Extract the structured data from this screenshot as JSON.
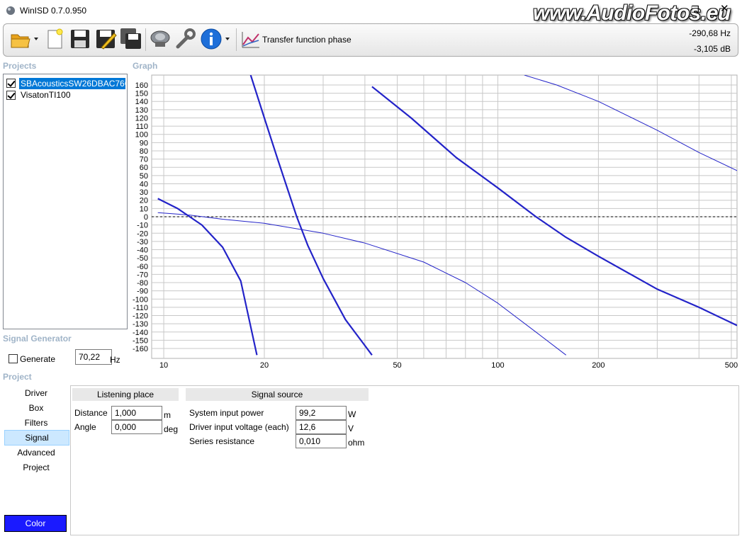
{
  "window": {
    "title": "WinISD 0.7.0.950",
    "watermark": "www.AudioFotos.eu",
    "maximize_glyph": "❐",
    "close_glyph": "✕"
  },
  "toolbar": {
    "buttons": [
      {
        "name": "open-folder-icon"
      },
      {
        "name": "new-project-icon"
      },
      {
        "name": "save-icon"
      },
      {
        "name": "save-edit-icon"
      },
      {
        "name": "save-all-icon"
      },
      {
        "name": "driver-icon"
      },
      {
        "name": "wrench-icon"
      },
      {
        "name": "info-icon"
      },
      {
        "name": "graph-type-icon"
      }
    ],
    "graph_type_label": "Transfer function phase",
    "readout_hz": "-290,68 Hz",
    "readout_db": "-3,105 dB"
  },
  "projects": {
    "header": "Projects",
    "items": [
      {
        "label": "SBAcousticsSW26DBAC76CI",
        "checked": true,
        "selected": true
      },
      {
        "label": "VisatonTI100",
        "checked": true,
        "selected": false
      }
    ]
  },
  "graph": {
    "header": "Graph"
  },
  "signal_generator": {
    "header": "Signal Generator",
    "generate_label": "Generate",
    "generate_checked": false,
    "frequency": "70,22",
    "unit": "Hz"
  },
  "project": {
    "header": "Project",
    "nav": [
      "Driver",
      "Box",
      "Filters",
      "Signal",
      "Advanced",
      "Project"
    ],
    "selected_nav": "Signal",
    "color_label": "Color",
    "color_value": "#1a1aff"
  },
  "signal_panel": {
    "listening_place": {
      "title": "Listening place",
      "distance_label": "Distance",
      "distance_value": "1,000",
      "distance_unit": "m",
      "angle_label": "Angle",
      "angle_value": "0,000",
      "angle_unit": "deg"
    },
    "signal_source": {
      "title": "Signal source",
      "power_label": "System input power",
      "power_value": "99,2",
      "power_unit": "W",
      "voltage_label": "Driver input voltage (each)",
      "voltage_value": "12,6",
      "voltage_unit": "V",
      "resistance_label": "Series resistance",
      "resistance_value": "0,010",
      "resistance_unit": "ohm"
    }
  },
  "chart_data": {
    "type": "line",
    "title": "",
    "xlabel": "",
    "ylabel": "",
    "x_scale": "log",
    "xlim": [
      9.2,
      520
    ],
    "ylim": [
      -172,
      172
    ],
    "x_ticks": [
      10,
      20,
      50,
      100,
      200,
      500
    ],
    "y_ticks": [
      160,
      150,
      140,
      130,
      120,
      110,
      100,
      90,
      80,
      70,
      60,
      50,
      40,
      30,
      20,
      10,
      0,
      -10,
      -20,
      -30,
      -40,
      -50,
      -60,
      -70,
      -80,
      -90,
      -100,
      -110,
      -120,
      -130,
      -140,
      -150,
      -160
    ],
    "grid": true,
    "line_color": "#2323c8",
    "reference_line": 0,
    "series": [
      {
        "width": 2.2,
        "points": [
          [
            9.6,
            22
          ],
          [
            11,
            10
          ],
          [
            13,
            -10
          ],
          [
            15,
            -37
          ],
          [
            17,
            -78
          ],
          [
            19,
            -168
          ]
        ]
      },
      {
        "width": 2.2,
        "points": [
          [
            18.2,
            172
          ],
          [
            20,
            120
          ],
          [
            22,
            68
          ],
          [
            25,
            0
          ],
          [
            27,
            -35
          ],
          [
            30,
            -75
          ],
          [
            35,
            -125
          ],
          [
            42,
            -168
          ]
        ]
      },
      {
        "width": 2.2,
        "points": [
          [
            42,
            158
          ],
          [
            55,
            120
          ],
          [
            75,
            72
          ],
          [
            100,
            35
          ],
          [
            130,
            0
          ],
          [
            160,
            -25
          ],
          [
            200,
            -48
          ],
          [
            300,
            -88
          ],
          [
            400,
            -110
          ],
          [
            520,
            -132
          ]
        ]
      },
      {
        "width": 1.0,
        "points": [
          [
            9.6,
            5
          ],
          [
            12,
            2
          ],
          [
            15,
            -3
          ],
          [
            20,
            -8
          ],
          [
            30,
            -20
          ],
          [
            40,
            -32
          ],
          [
            60,
            -55
          ],
          [
            80,
            -80
          ],
          [
            100,
            -105
          ],
          [
            130,
            -140
          ],
          [
            160,
            -168
          ]
        ]
      },
      {
        "width": 1.0,
        "points": [
          [
            120,
            172
          ],
          [
            150,
            160
          ],
          [
            200,
            140
          ],
          [
            300,
            105
          ],
          [
            400,
            78
          ],
          [
            520,
            56
          ]
        ]
      }
    ]
  }
}
